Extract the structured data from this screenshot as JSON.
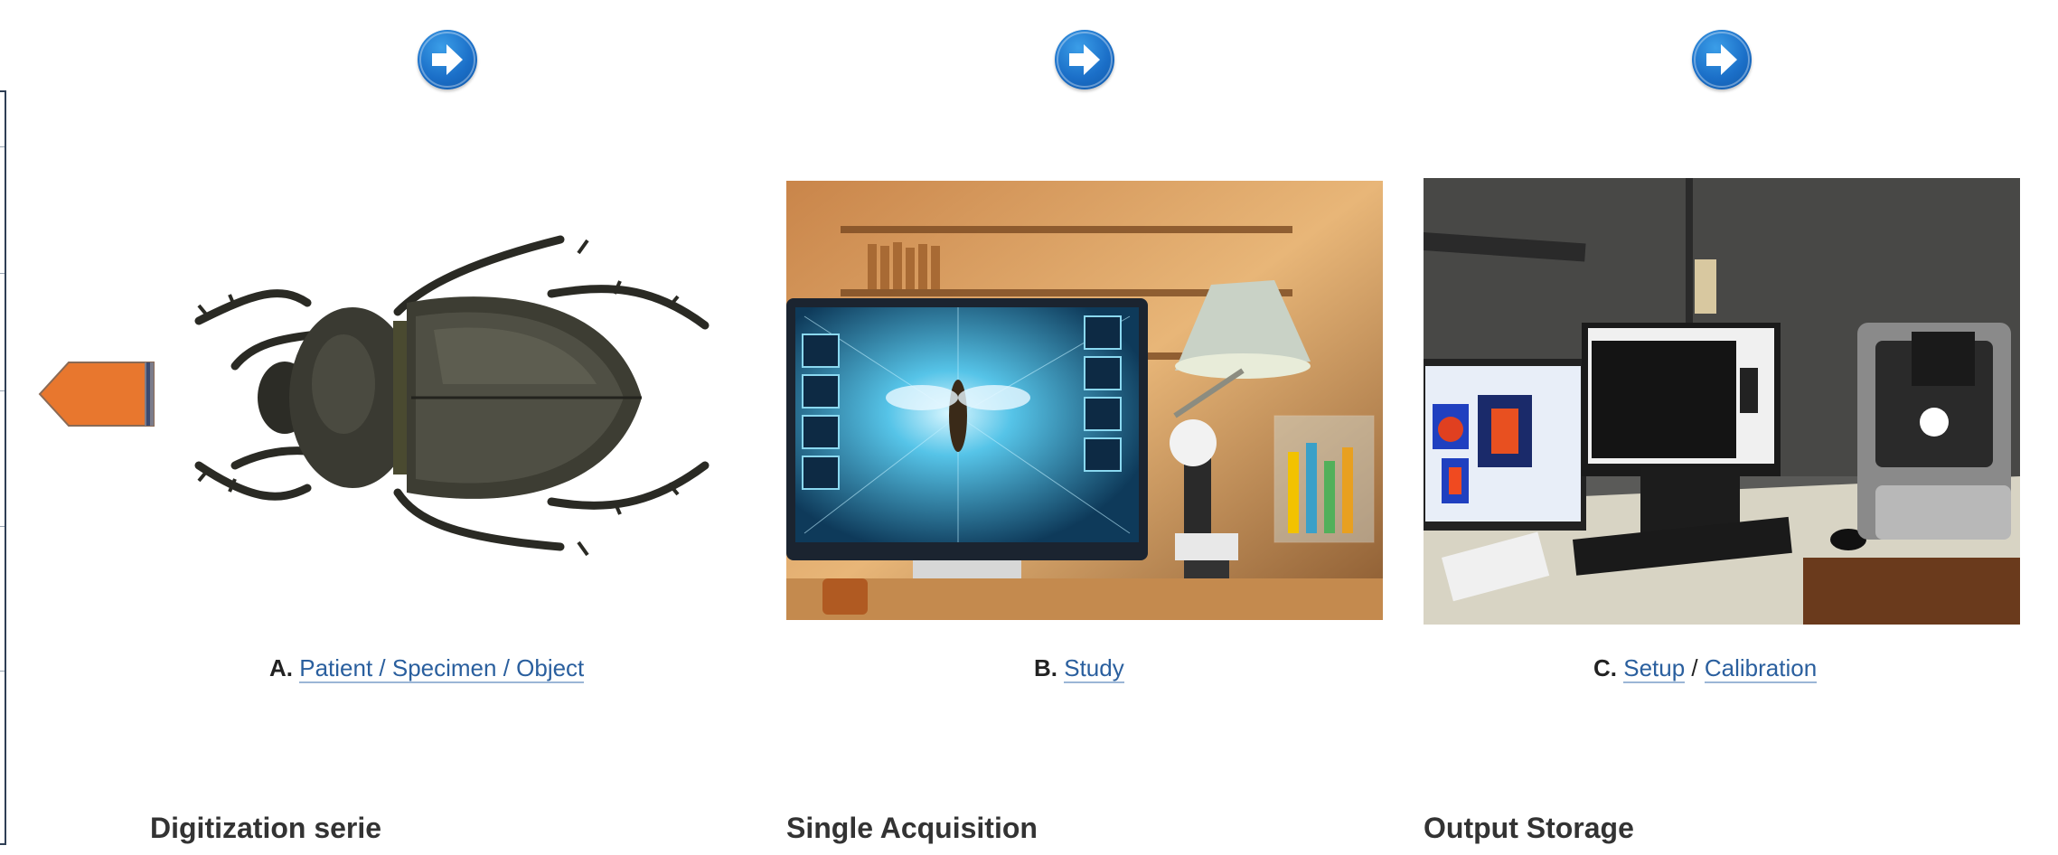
{
  "panels": [
    {
      "arrow_icon": "arrow-circle-right-icon",
      "image_icon": "beetle-specimen-image",
      "caption_letter": "A.",
      "link1": "Patient / Specimen / Object",
      "title": "Digitization serie"
    },
    {
      "arrow_icon": "arrow-circle-right-icon",
      "image_icon": "lab-study-image",
      "caption_letter": "B.",
      "link1": "Study",
      "title": "Single Acquisition"
    },
    {
      "arrow_icon": "arrow-circle-right-icon",
      "image_icon": "scanner-workstation-image",
      "caption_letter": "C.",
      "link1": "Setup",
      "separator": "/",
      "link2": "Calibration",
      "title": "Output Storage"
    }
  ],
  "colors": {
    "arrow_blue": "#1b6fc8",
    "back_arrow_orange": "#e8772e",
    "link_blue": "#2a5f9e"
  }
}
